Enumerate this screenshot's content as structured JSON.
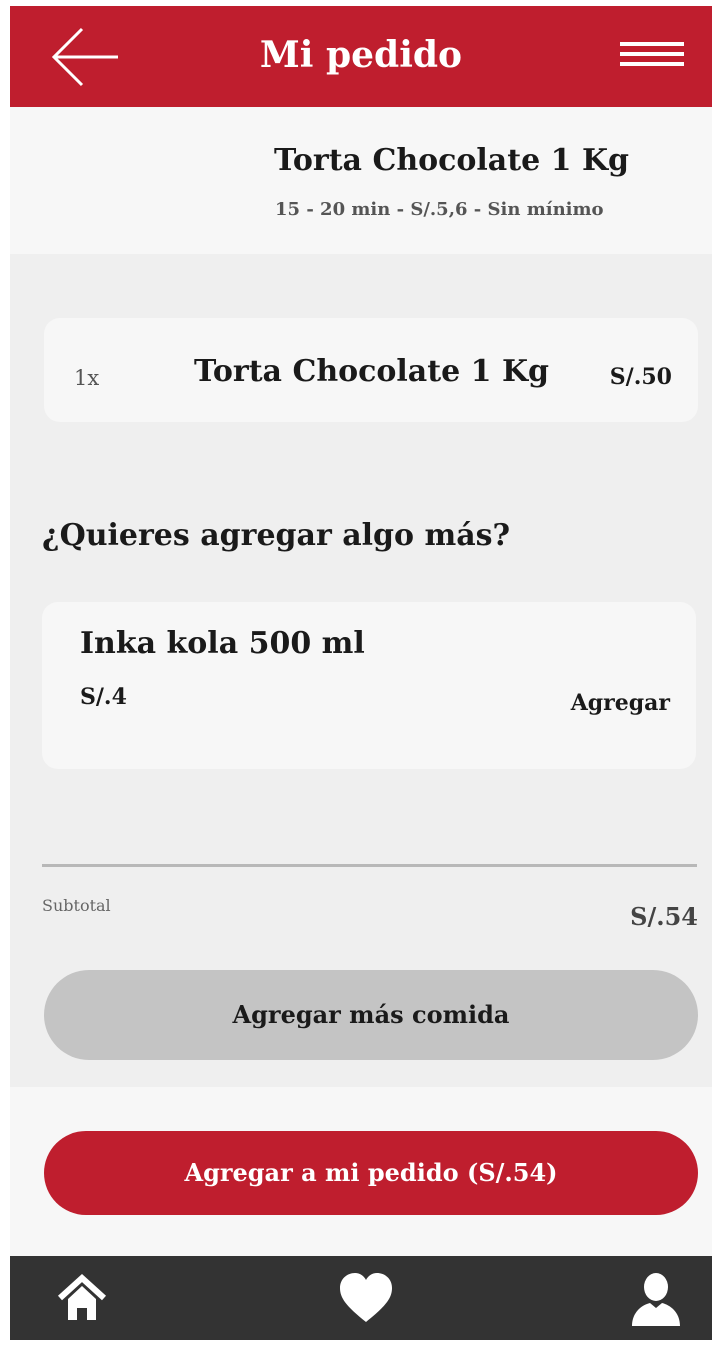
{
  "header": {
    "title": "Mi pedido",
    "back_icon": "arrow-left-icon",
    "menu_icon": "hamburger-menu-icon",
    "color": "#bf1e2e"
  },
  "store": {
    "name": "Torta Chocolate 1 Kg",
    "meta": "15 - 20 min - S/.5,6 - Sin mínimo"
  },
  "order_item": {
    "quantity": "1x",
    "name": "Torta Chocolate 1 Kg",
    "price": "S/.50"
  },
  "suggestions": {
    "title": "¿Quieres agregar algo más?",
    "items": [
      {
        "name": "Inka kola 500 ml",
        "price": "S/.4",
        "action": "Agregar"
      }
    ]
  },
  "subtotal": {
    "label": "Subtotal",
    "value": "S/.54"
  },
  "buttons": {
    "more_food": "Agregar más comida",
    "add_to_order": "Agregar a mi pedido (S/.54)"
  },
  "bottom_nav": {
    "items": [
      {
        "icon": "home-icon"
      },
      {
        "icon": "heart-icon"
      },
      {
        "icon": "user-icon"
      }
    ],
    "background": "#333333"
  }
}
